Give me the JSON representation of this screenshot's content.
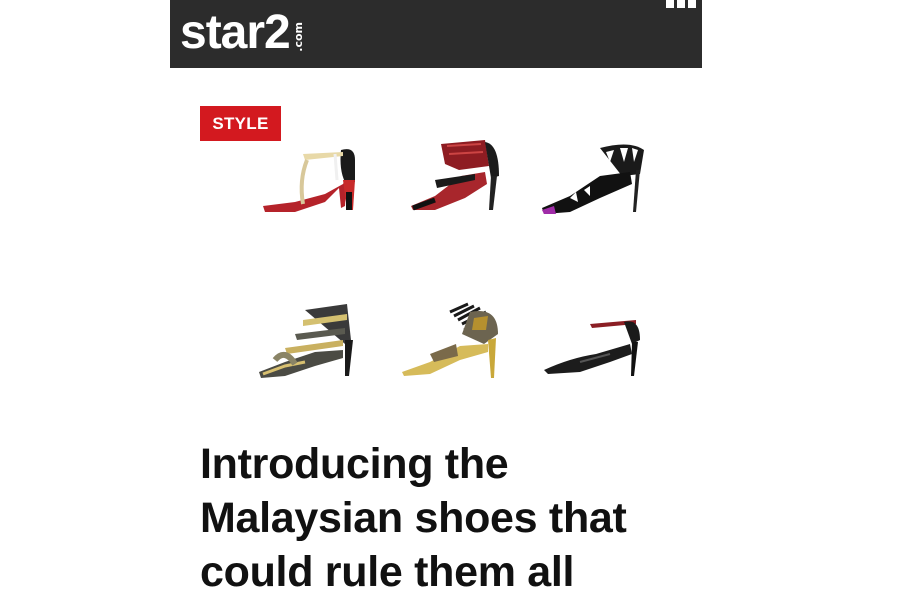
{
  "header": {
    "logo_text": "star2",
    "logo_suffix": ".com",
    "menu_icon": "grid-menu-icon",
    "background_color": "#2c2c2c"
  },
  "article": {
    "category_badge": "STYLE",
    "badge_color": "#d3191f",
    "headline": "Introducing the Malaysian shoes that could rule them all",
    "hero_image": {
      "shoes": [
        {
          "icon": "sandal-red-black-icon"
        },
        {
          "icon": "sandal-red-studded-icon"
        },
        {
          "icon": "sandal-black-cutout-icon"
        },
        {
          "icon": "sandal-snakeskin-strappy-icon"
        },
        {
          "icon": "sandal-gold-snakeskin-icon"
        },
        {
          "icon": "pump-black-patent-icon"
        }
      ]
    }
  }
}
